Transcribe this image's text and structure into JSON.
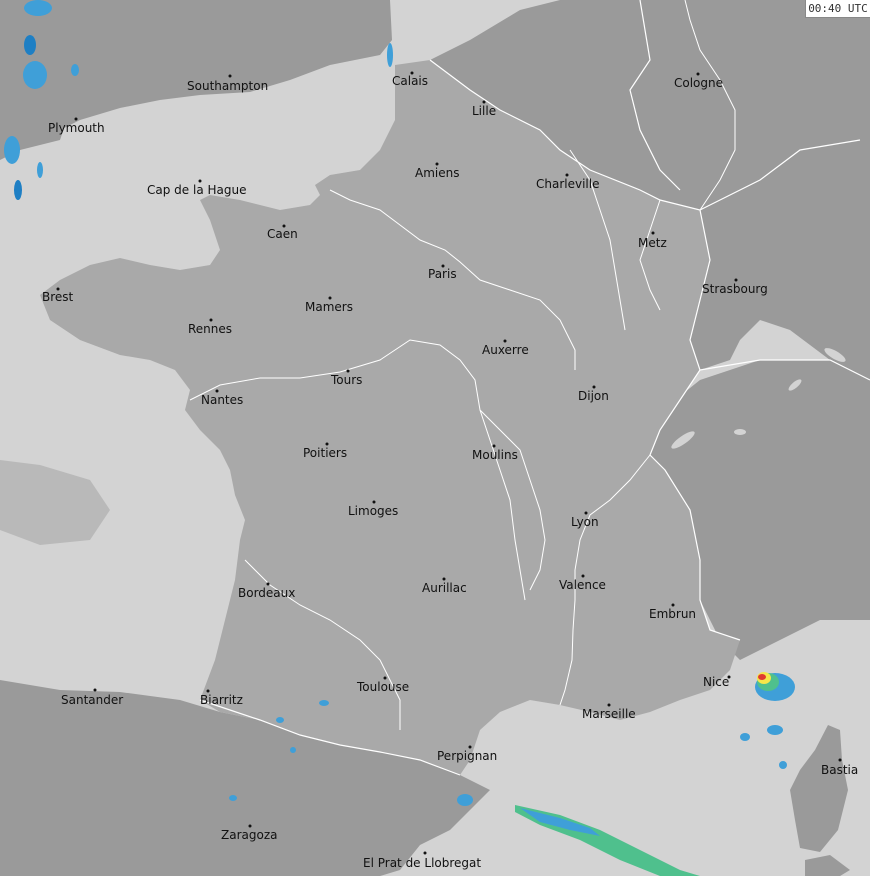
{
  "timestamp": "00:40 UTC",
  "colors": {
    "sea": "#d3d3d3",
    "france": "#a9a9a9",
    "neighbors": "#9a9a9a",
    "rivers": "#ffffff",
    "borders": "#ffffff",
    "radar_light": "#3f9fd8",
    "radar_mid": "#1e7fc4",
    "radar_green": "#4fc08d",
    "radar_yellow": "#f5e64a",
    "radar_red": "#e03a2f"
  },
  "cities": [
    {
      "name": "Southampton"
    },
    {
      "name": "Calais"
    },
    {
      "name": "Cologne"
    },
    {
      "name": "Plymouth"
    },
    {
      "name": "Lille"
    },
    {
      "name": "Amiens"
    },
    {
      "name": "Charleville"
    },
    {
      "name": "Cap de la Hague"
    },
    {
      "name": "Caen"
    },
    {
      "name": "Metz"
    },
    {
      "name": "Paris"
    },
    {
      "name": "Strasbourg"
    },
    {
      "name": "Brest"
    },
    {
      "name": "Mamers"
    },
    {
      "name": "Rennes"
    },
    {
      "name": "Auxerre"
    },
    {
      "name": "Tours"
    },
    {
      "name": "Dijon"
    },
    {
      "name": "Nantes"
    },
    {
      "name": "Poitiers"
    },
    {
      "name": "Moulins"
    },
    {
      "name": "Limoges"
    },
    {
      "name": "Lyon"
    },
    {
      "name": "Valence"
    },
    {
      "name": "Bordeaux"
    },
    {
      "name": "Aurillac"
    },
    {
      "name": "Embrun"
    },
    {
      "name": "Toulouse"
    },
    {
      "name": "Nice"
    },
    {
      "name": "Santander"
    },
    {
      "name": "Biarritz"
    },
    {
      "name": "Marseille"
    },
    {
      "name": "Perpignan"
    },
    {
      "name": "Bastia"
    },
    {
      "name": "Zaragoza"
    },
    {
      "name": "El Prat de Llobregat"
    }
  ]
}
